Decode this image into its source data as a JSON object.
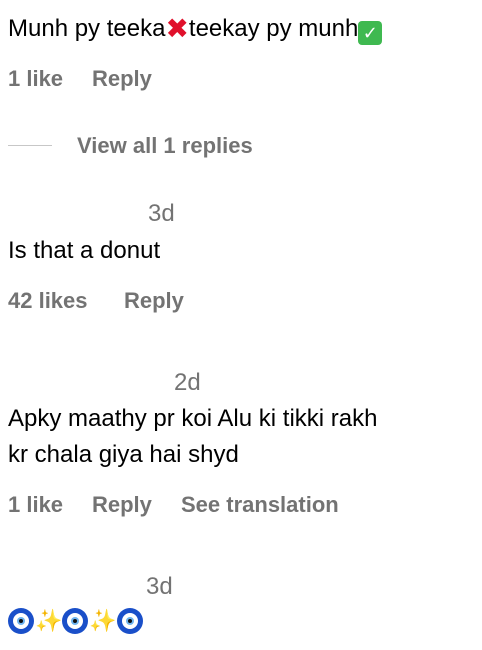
{
  "comments": [
    {
      "text_before": "Munh py teeka",
      "cross": "✖",
      "text_after": "teekay py munh",
      "check": "✓",
      "likes": "1 like",
      "reply": "Reply"
    },
    {
      "timestamp": "3d",
      "text": "Is that a donut",
      "likes": "42 likes",
      "reply": "Reply"
    },
    {
      "timestamp": "2d",
      "text_line1": "Apky maathy pr koi Alu ki tikki rakh",
      "text_line2": "kr chala giya hai shyd",
      "likes": "1 like",
      "reply": "Reply",
      "translate": "See translation"
    },
    {
      "timestamp": "3d",
      "emoji": [
        "evil-eye",
        "sparkles",
        "evil-eye",
        "sparkles",
        "evil-eye"
      ],
      "sparkle_glyph": "✨"
    }
  ],
  "view_replies": "View all 1 replies",
  "colors": {
    "text": "#000000",
    "secondary": "#737373",
    "divider": "#c7c7c7",
    "cross": "#e0102b",
    "check_bg": "#3fb950"
  }
}
